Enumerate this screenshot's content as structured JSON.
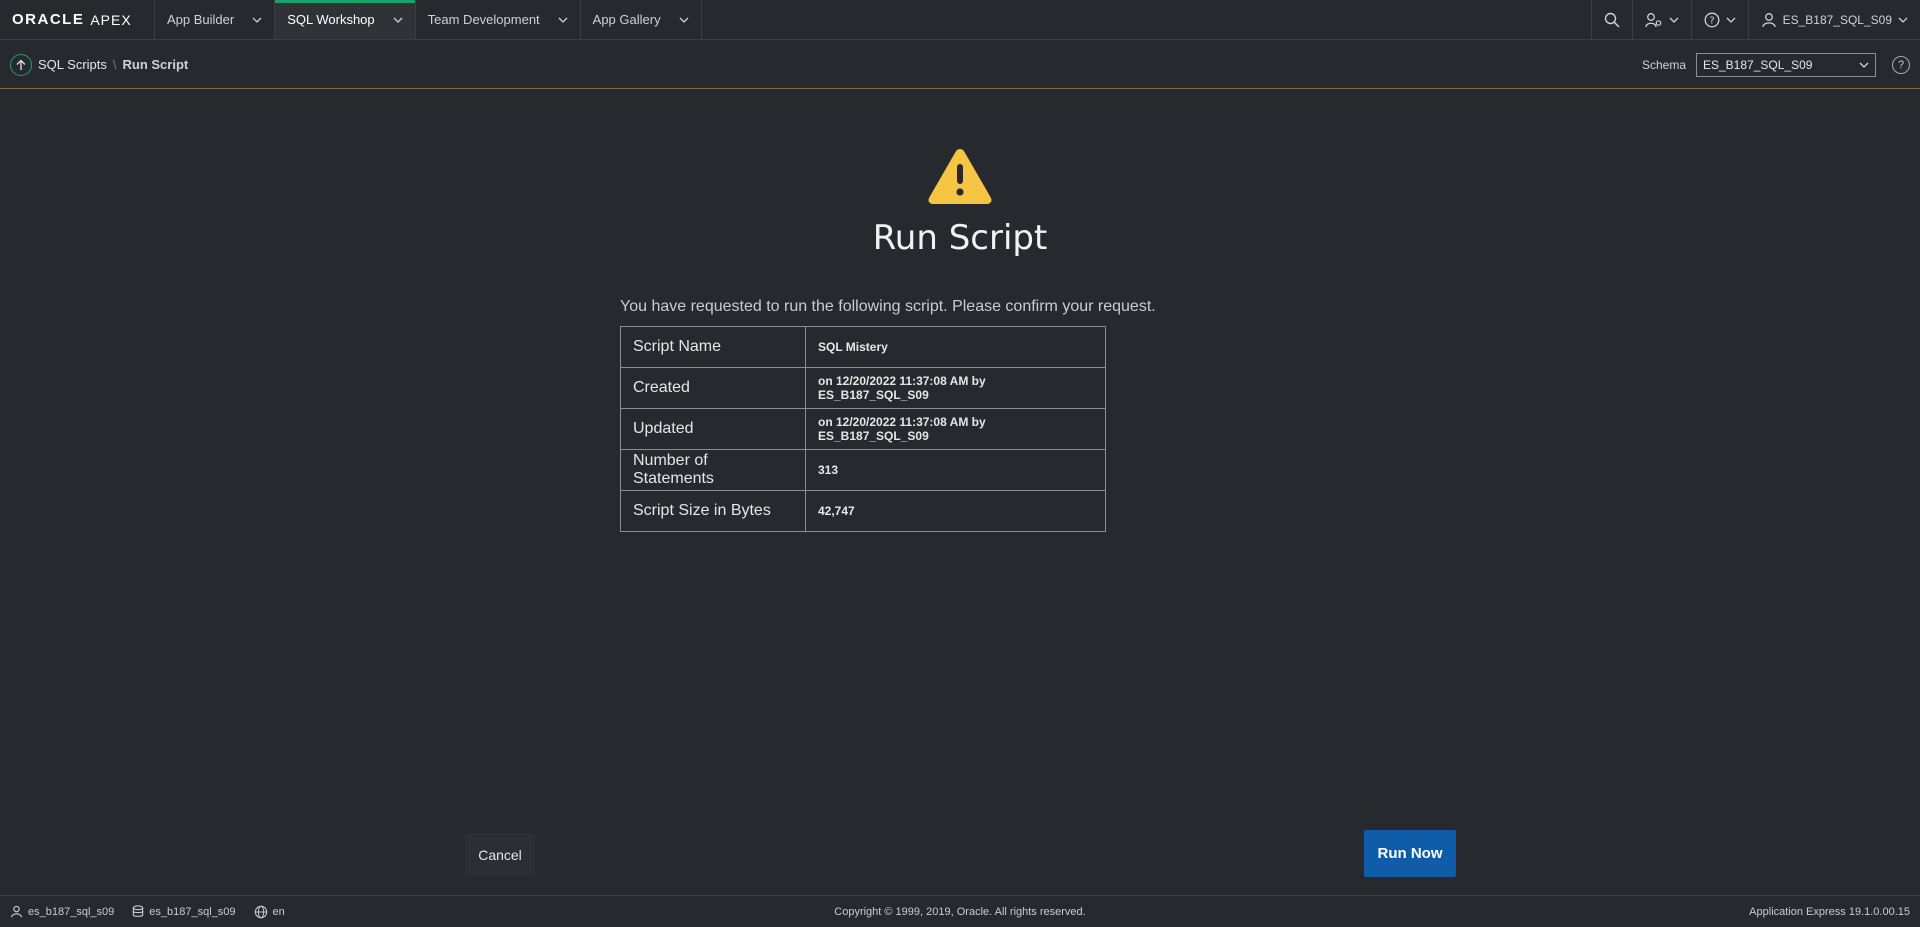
{
  "nav": {
    "logo_oracle": "ORACLE",
    "logo_apex": "APEX",
    "tabs": [
      {
        "label": "App Builder"
      },
      {
        "label": "SQL Workshop"
      },
      {
        "label": "Team Development"
      },
      {
        "label": "App Gallery"
      }
    ],
    "active_tab": "SQL Workshop",
    "user": "ES_B187_SQL_S09",
    "accent_color": "#1ba26a"
  },
  "breadcrumb": {
    "parent": "SQL Scripts",
    "current": "Run Script"
  },
  "schema": {
    "label": "Schema",
    "value": "ES_B187_SQL_S09"
  },
  "main": {
    "title": "Run Script",
    "intro": "You have requested to run the following script. Please confirm your request.",
    "rows": [
      {
        "key": "Script Name",
        "value": "SQL Mistery"
      },
      {
        "key": "Created",
        "value": "on 12/20/2022 11:37:08 AM by ES_B187_SQL_S09"
      },
      {
        "key": "Updated",
        "value": "on 12/20/2022 11:37:08 AM by ES_B187_SQL_S09"
      },
      {
        "key": "Number of Statements",
        "value": "313"
      },
      {
        "key": "Script Size in Bytes",
        "value": "42,747"
      }
    ],
    "cancel_label": "Cancel",
    "run_label": "Run Now",
    "run_color": "#0f5ca8",
    "warning_color": "#f7c544"
  },
  "footer": {
    "user": "es_b187_sql_s09",
    "schema": "es_b187_sql_s09",
    "language": "en",
    "copyright": "Copyright © 1999, 2019, Oracle. All rights reserved.",
    "version": "Application Express 19.1.0.00.15"
  }
}
